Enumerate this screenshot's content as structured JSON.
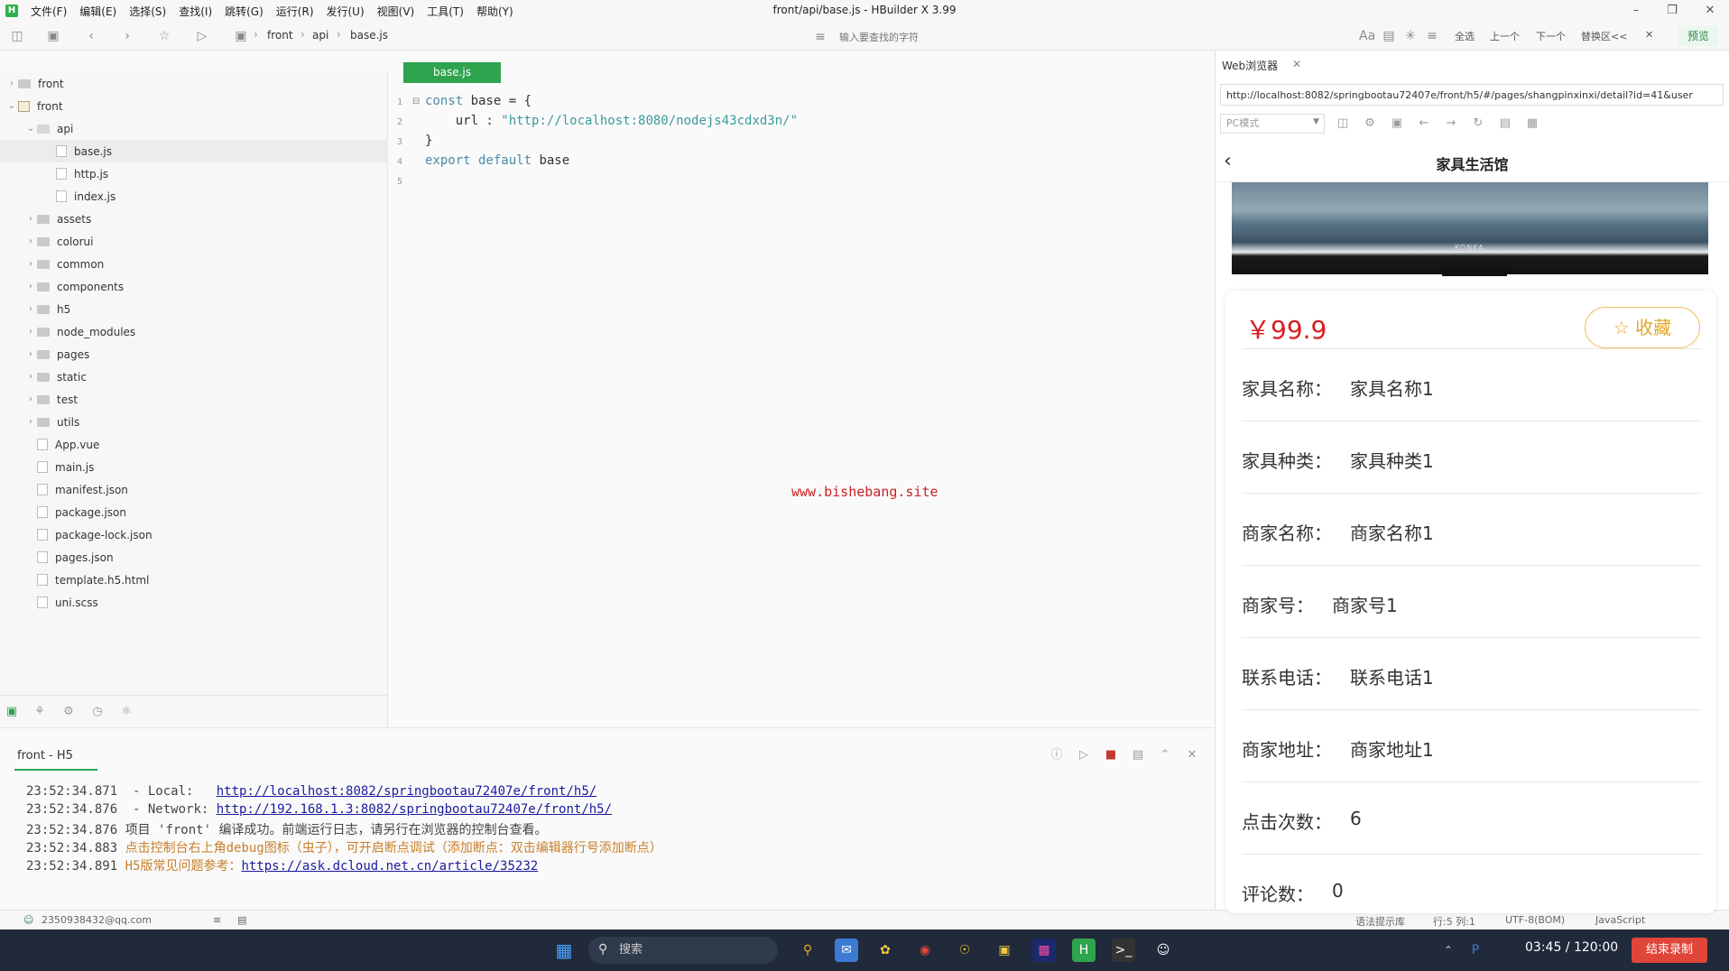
{
  "window": {
    "title": "front/api/base.js - HBuilder X 3.99",
    "logo_glyph": "H",
    "minimize": "–",
    "restore": "❐",
    "close": "✕"
  },
  "menu": [
    "文件(F)",
    "编辑(E)",
    "选择(S)",
    "查找(I)",
    "跳转(G)",
    "运行(R)",
    "发行(U)",
    "视图(V)",
    "工具(T)",
    "帮助(Y)"
  ],
  "toolbar": {
    "breadcrumb": [
      "front",
      "api",
      "base.js"
    ],
    "breadcrumb_sep": "›",
    "search_placeholder": "输入要查找的字符",
    "actions": [
      "全选",
      "上一个",
      "下一个",
      "替换区<<"
    ],
    "preview_label": "预览",
    "close_glyph": "✕"
  },
  "sidebar": {
    "items": [
      {
        "label": "front",
        "kind": "folder",
        "arrow": "›"
      },
      {
        "label": "front",
        "kind": "project",
        "arrow": "⌄"
      },
      {
        "label": "api",
        "kind": "folder-open",
        "arrow": "⌄"
      },
      {
        "label": "base.js",
        "kind": "file",
        "arrow": ""
      },
      {
        "label": "http.js",
        "kind": "file",
        "arrow": ""
      },
      {
        "label": "index.js",
        "kind": "file",
        "arrow": ""
      },
      {
        "label": "assets",
        "kind": "folder",
        "arrow": "›"
      },
      {
        "label": "colorui",
        "kind": "folder",
        "arrow": "›"
      },
      {
        "label": "common",
        "kind": "folder",
        "arrow": "›"
      },
      {
        "label": "components",
        "kind": "folder",
        "arrow": "›"
      },
      {
        "label": "h5",
        "kind": "folder",
        "arrow": "›"
      },
      {
        "label": "node_modules",
        "kind": "folder",
        "arrow": "›"
      },
      {
        "label": "pages",
        "kind": "folder",
        "arrow": "›"
      },
      {
        "label": "static",
        "kind": "folder",
        "arrow": "›"
      },
      {
        "label": "test",
        "kind": "folder",
        "arrow": "›"
      },
      {
        "label": "utils",
        "kind": "folder",
        "arrow": "›"
      },
      {
        "label": "App.vue",
        "kind": "file",
        "arrow": ""
      },
      {
        "label": "main.js",
        "kind": "file",
        "arrow": ""
      },
      {
        "label": "manifest.json",
        "kind": "file",
        "arrow": ""
      },
      {
        "label": "package.json",
        "kind": "file",
        "arrow": ""
      },
      {
        "label": "package-lock.json",
        "kind": "file",
        "arrow": ""
      },
      {
        "label": "pages.json",
        "kind": "file",
        "arrow": ""
      },
      {
        "label": "template.h5.html",
        "kind": "file",
        "arrow": ""
      },
      {
        "label": "uni.scss",
        "kind": "file",
        "arrow": ""
      }
    ],
    "selected": "base.js"
  },
  "editor": {
    "tab_label": "base.js",
    "lines": [
      {
        "no": "1",
        "parts": [
          [
            "kw",
            "const "
          ],
          [
            "plain",
            "base = {"
          ]
        ]
      },
      {
        "no": "2",
        "parts": [
          [
            "plain",
            "    url : "
          ],
          [
            "str",
            "\"http://localhost:8080/nodejs43cdxd3n/\""
          ]
        ]
      },
      {
        "no": "3",
        "parts": [
          [
            "plain",
            "}"
          ]
        ]
      },
      {
        "no": "4",
        "parts": [
          [
            "kw",
            "export default "
          ],
          [
            "plain",
            "base"
          ]
        ]
      },
      {
        "no": "5",
        "parts": []
      }
    ],
    "fold_glyph": "⊟",
    "watermark": "www.bishebang.site"
  },
  "console": {
    "tab_label": "front - H5",
    "lines": [
      {
        "time": "23:52:34.871",
        "text": "  - Local:   ",
        "link": "http://localhost:8082/springbootau72407e/front/h5/",
        "style": "normal"
      },
      {
        "time": "23:52:34.876",
        "text": "  - Network: ",
        "link": "http://192.168.1.3:8082/springbootau72407e/front/h5/",
        "style": "normal"
      },
      {
        "time": "23:52:34.876",
        "text": " 项目 'front' 编译成功。前端运行日志，请另行在浏览器的控制台查看。",
        "link": "",
        "style": "normal"
      },
      {
        "time": "23:52:34.883",
        "text": " 点击控制台右上角debug图标（虫子），可开启断点调试（添加断点：双击编辑器行号添加断点）",
        "link": "",
        "style": "warn"
      },
      {
        "time": "23:52:34.891",
        "text": " H5版常见问题参考：",
        "link": "https://ask.dcloud.net.cn/article/35232",
        "style": "warn"
      }
    ]
  },
  "statusbar": {
    "user": "2350938432@qq.com",
    "syntax": "语法提示库",
    "position": "行:5  列:1",
    "encoding": "UTF-8(BOM)",
    "language": "JavaScript"
  },
  "browser": {
    "tab_label": "Web浏览器",
    "url": "http://localhost:8082/springbootau72407e/front/h5/#/pages/shangpinxinxi/detail?id=41&user",
    "mode": "PC模式",
    "page_title": "家具生活馆",
    "tv_logo": "KONKA",
    "price": "￥99.9",
    "fav_label": "☆ 收藏",
    "details": [
      {
        "label": "家具名称：",
        "value": "家具名称1"
      },
      {
        "label": "家具种类：",
        "value": "家具种类1"
      },
      {
        "label": "商家名称：",
        "value": "商家名称1"
      },
      {
        "label": "商家号：",
        "value": "商家号1"
      },
      {
        "label": "联系电话：",
        "value": "联系电话1"
      },
      {
        "label": "商家地址：",
        "value": "商家地址1"
      },
      {
        "label": "点击次数：",
        "value": "6"
      },
      {
        "label": "评论数：",
        "value": "0"
      }
    ]
  },
  "taskbar": {
    "search_label": "搜索",
    "rec_time": "03:45 / 120:00",
    "rec_button": "结束录制"
  },
  "colors": {
    "accent_green": "#2fa44f",
    "price_red": "#d61e1e",
    "fav_gold": "#e0a628"
  }
}
